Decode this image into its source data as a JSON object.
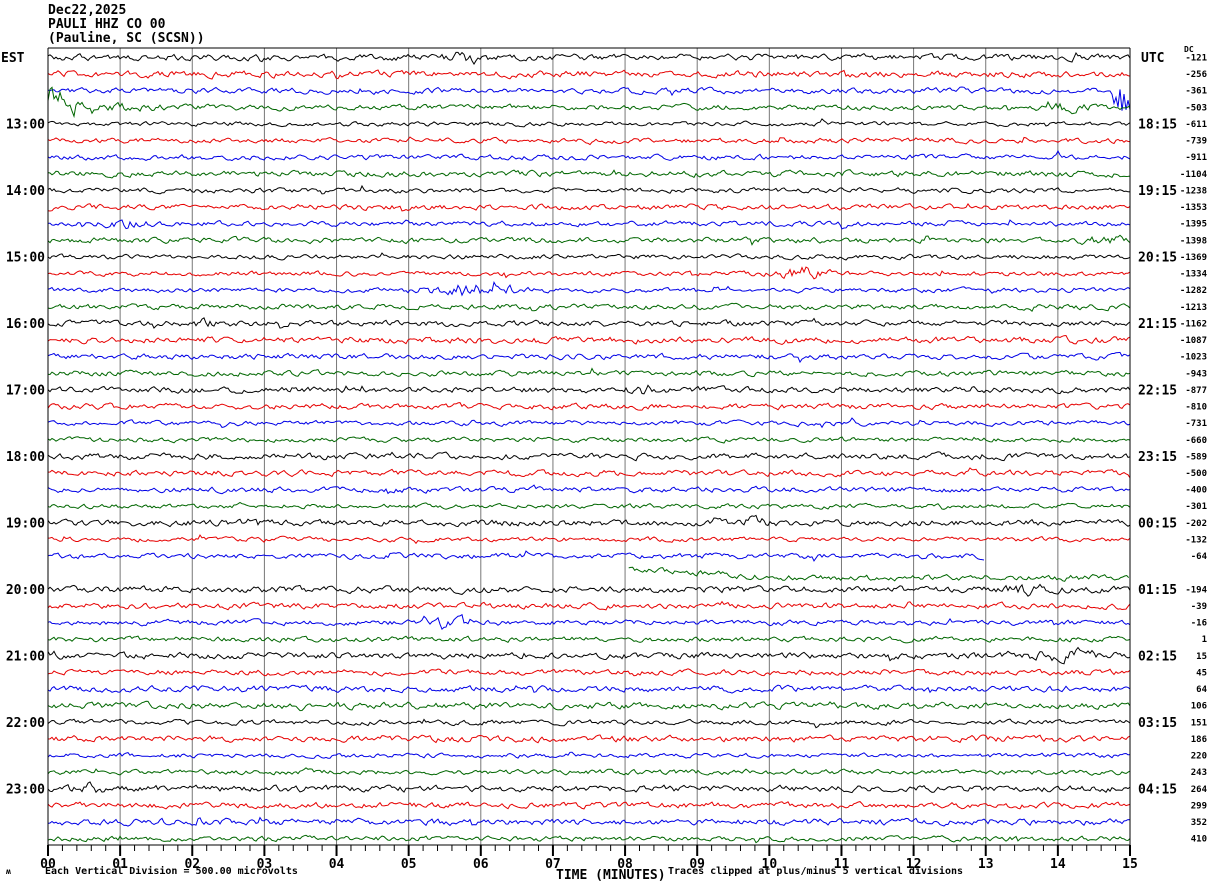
{
  "header": {
    "date": "Dec22,2025",
    "station": "PAULI HHZ CO 00",
    "location": "(Pauline, SC (SCSN))"
  },
  "left_axis": {
    "label": "EST",
    "hours": [
      "13:00",
      "14:00",
      "15:00",
      "16:00",
      "17:00",
      "18:00",
      "19:00",
      "20:00",
      "21:00",
      "22:00",
      "23:00"
    ]
  },
  "right_axis": {
    "label": "UTC",
    "dc_label": "DC",
    "hours": [
      "18:15",
      "19:15",
      "20:15",
      "21:15",
      "22:15",
      "23:15",
      "00:15",
      "01:15",
      "02:15",
      "03:15",
      "04:15"
    ],
    "dc_values": [
      "-121",
      "-256",
      "-361",
      "-503",
      "-611",
      "-739",
      "-911",
      "-1104",
      "-1238",
      "-1353",
      "-1395",
      "-1398",
      "-1369",
      "-1334",
      "-1282",
      "-1213",
      "-1162",
      "-1087",
      "-1023",
      "-943",
      "-877",
      "-810",
      "-731",
      "-660",
      "-589",
      "-500",
      "-400",
      "-301",
      "-202",
      "-132",
      "-64",
      "",
      "-194",
      "-39",
      "-16",
      "1",
      "15",
      "45",
      "64",
      "106",
      "151",
      "186",
      "220",
      "243",
      "264",
      "299",
      "352",
      "410"
    ]
  },
  "x_axis": {
    "title": "TIME (MINUTES)",
    "tick_labels": [
      "00",
      "01",
      "02",
      "03",
      "04",
      "05",
      "06",
      "07",
      "08",
      "09",
      "10",
      "11",
      "12",
      "13",
      "14",
      "15"
    ]
  },
  "footer": {
    "left_glyph": "ʍ",
    "left_text": "Each Vertical Division = 500.00 microvolts",
    "right_text": "Traces clipped at plus/minus 5 vertical divisions"
  },
  "colors": {
    "background": "#ffffff",
    "grid": "#777777",
    "border": "#000000",
    "trace_black": "#000000",
    "trace_red": "#e60000",
    "trace_blue": "#0000e6",
    "trace_green": "#006600"
  },
  "chart_data": {
    "type": "line",
    "subtype": "helicorder-seismogram",
    "title": "PAULI HHZ CO 00 (Pauline, SC (SCSN)) Dec22,2025",
    "xlabel": "TIME (MINUTES)",
    "x_range_minutes": [
      0,
      15
    ],
    "x_major_tick_minutes": 1,
    "x_minor_ticks_per_major": 5,
    "num_rows": 48,
    "minutes_per_row": 15,
    "row_color_cycle": [
      "#000000",
      "#e60000",
      "#0000e6",
      "#006600"
    ],
    "first_hour_label_row": 4,
    "hour_label_row_interval": 4,
    "left_hour_labels_est": [
      "13:00",
      "14:00",
      "15:00",
      "16:00",
      "17:00",
      "18:00",
      "19:00",
      "20:00",
      "21:00",
      "22:00",
      "23:00"
    ],
    "right_hour_labels_utc": [
      "18:15",
      "19:15",
      "20:15",
      "21:15",
      "22:15",
      "23:15",
      "00:15",
      "01:15",
      "02:15",
      "03:15",
      "04:15"
    ],
    "dc_offsets": [
      -121,
      -256,
      -361,
      -503,
      -611,
      -739,
      -911,
      -1104,
      -1238,
      -1353,
      -1395,
      -1398,
      -1369,
      -1334,
      -1282,
      -1213,
      -1162,
      -1087,
      -1023,
      -943,
      -877,
      -810,
      -731,
      -660,
      -589,
      -500,
      -400,
      -301,
      -202,
      -132,
      -64,
      null,
      -194,
      -39,
      -16,
      1,
      15,
      45,
      64,
      106,
      151,
      186,
      220,
      243,
      264,
      299,
      352,
      410
    ],
    "microvolts_per_division": 500,
    "clip_divisions": 5,
    "grid": true,
    "notable_events": [
      {
        "row": 0,
        "start_min": 5.5,
        "end_min": 6.1,
        "amplitude": "small"
      },
      {
        "row": 2,
        "start_min": 14.7,
        "end_min": 15.0,
        "amplitude": "large",
        "note": "clipped burst at end of row"
      },
      {
        "row": 3,
        "start_min": 0.0,
        "end_min": 1.6,
        "amplitude": "large",
        "note": "clipped burst decaying from row start"
      },
      {
        "row": 3,
        "start_min": 13.8,
        "end_min": 14.5,
        "amplitude": "small"
      },
      {
        "row": 10,
        "start_min": 0.8,
        "end_min": 1.4,
        "amplitude": "small"
      },
      {
        "row": 11,
        "start_min": 14.3,
        "end_min": 15.0,
        "amplitude": "small"
      },
      {
        "row": 13,
        "start_min": 10.0,
        "end_min": 10.8,
        "amplitude": "moderate"
      },
      {
        "row": 14,
        "start_min": 5.2,
        "end_min": 6.6,
        "amplitude": "moderate"
      },
      {
        "row": 16,
        "start_min": 2.0,
        "end_min": 2.4,
        "amplitude": "small"
      },
      {
        "row": 20,
        "start_min": 8.0,
        "end_min": 8.6,
        "amplitude": "small"
      },
      {
        "row": 28,
        "start_min": 9.6,
        "end_min": 10.0,
        "amplitude": "small"
      },
      {
        "row": 32,
        "start_min": 13.3,
        "end_min": 13.8,
        "amplitude": "small"
      },
      {
        "row": 34,
        "start_min": 5.3,
        "end_min": 5.9,
        "amplitude": "moderate"
      },
      {
        "row": 36,
        "start_min": 13.6,
        "end_min": 14.7,
        "amplitude": "small"
      },
      {
        "row": 44,
        "start_min": 0.3,
        "end_min": 0.8,
        "amplitude": "small"
      }
    ],
    "data_gaps": [
      {
        "row": 30,
        "end_min": 13.0,
        "note": "trace ends at minute 13"
      },
      {
        "row": 31,
        "start_min": 8.05,
        "note": "trace starts at minute 8, baseline drifts downward, no DC value"
      }
    ]
  }
}
